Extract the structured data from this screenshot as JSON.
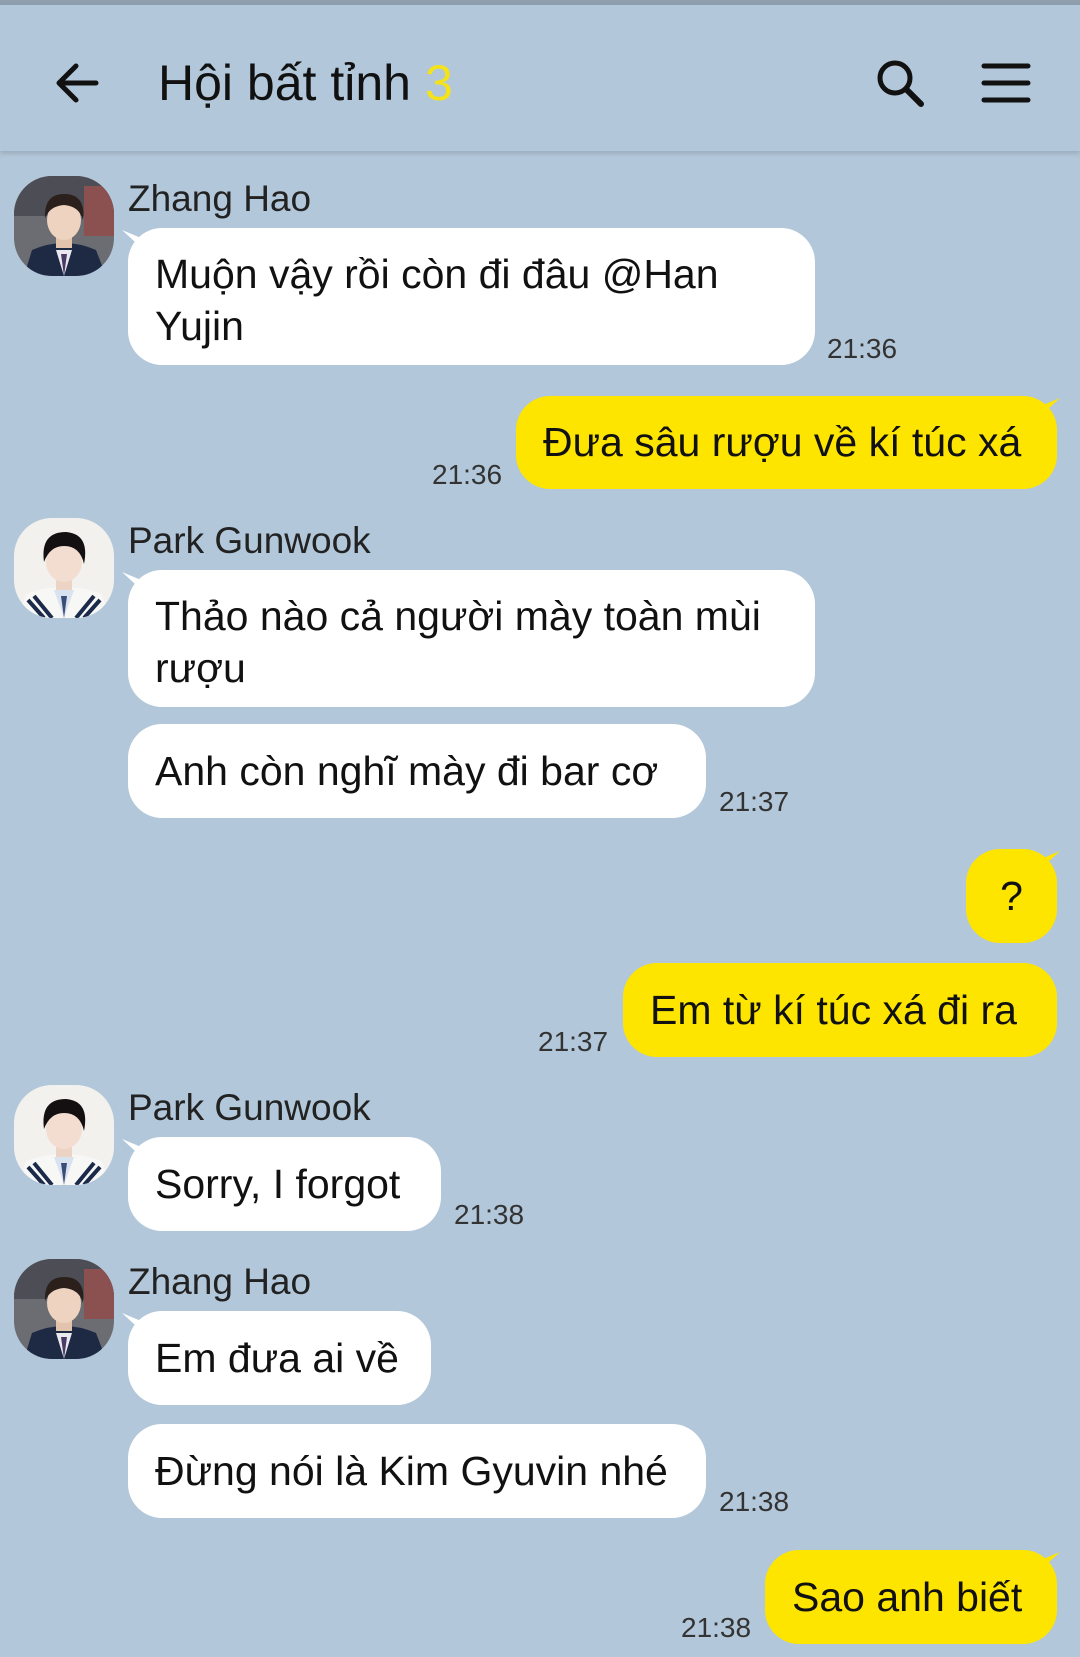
{
  "header": {
    "title": "Hội bất tỉnh",
    "member_count": "3"
  },
  "colors": {
    "background": "#b2c7d9",
    "incoming_bubble": "#ffffff",
    "outgoing_bubble": "#fee500",
    "count_accent": "#f5e31a"
  },
  "messages": [
    {
      "type": "incoming",
      "sender": "Zhang Hao",
      "text": "Muộn vậy rồi còn đi đâu @Han Yujin",
      "time": "21:36"
    },
    {
      "type": "outgoing",
      "text": "Đưa sâu rượu về kí túc xá",
      "time": "21:36"
    },
    {
      "type": "incoming",
      "sender": "Park Gunwook",
      "text": "Thảo nào cả người mày toàn mùi rượu"
    },
    {
      "type": "incoming",
      "text": "Anh còn nghĩ mày đi bar cơ",
      "time": "21:37"
    },
    {
      "type": "outgoing",
      "text": "?"
    },
    {
      "type": "outgoing",
      "text": "Em từ kí túc xá đi ra",
      "time": "21:37"
    },
    {
      "type": "incoming",
      "sender": "Park Gunwook",
      "text": "Sorry, I forgot",
      "time": "21:38"
    },
    {
      "type": "incoming",
      "sender": "Zhang Hao",
      "text": "Em đưa ai về"
    },
    {
      "type": "incoming",
      "text": "Đừng nói là Kim Gyuvin nhé",
      "time": "21:38"
    },
    {
      "type": "outgoing",
      "text": "Sao anh biết",
      "time": "21:38"
    }
  ]
}
